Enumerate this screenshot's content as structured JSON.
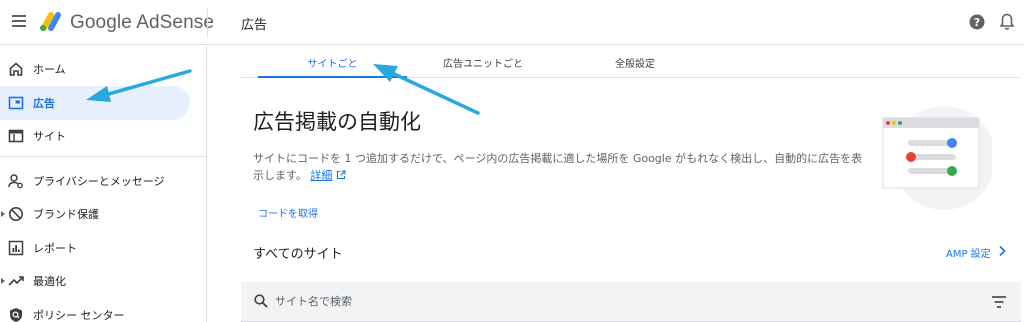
{
  "app": {
    "brand_name": "Google AdSense",
    "page_title": "広告"
  },
  "sidebar": {
    "items": [
      {
        "label": "ホーム",
        "icon": "home-icon",
        "active": false,
        "expandable": false
      },
      {
        "label": "広告",
        "icon": "ads-icon",
        "active": true,
        "expandable": false
      },
      {
        "label": "サイト",
        "icon": "sites-icon",
        "active": false,
        "expandable": false
      },
      {
        "label": "プライバシーとメッセージ",
        "icon": "privacy-icon",
        "active": false,
        "expandable": false
      },
      {
        "label": "ブランド保護",
        "icon": "block-icon",
        "active": false,
        "expandable": true
      },
      {
        "label": "レポート",
        "icon": "report-icon",
        "active": false,
        "expandable": false
      },
      {
        "label": "最適化",
        "icon": "trending-up-icon",
        "active": false,
        "expandable": true
      },
      {
        "label": "ポリシー センター",
        "icon": "policy-icon",
        "active": false,
        "expandable": false
      }
    ]
  },
  "tabs": [
    {
      "label": "サイトごと",
      "active": true
    },
    {
      "label": "広告ユニットごと",
      "active": false
    },
    {
      "label": "全般設定",
      "active": false
    }
  ],
  "main": {
    "heading": "広告掲載の自動化",
    "description_line1": "サイトにコードを 1 つ追加するだけで、ページ内の広告掲載に適した場所を Google がもれなく検出し、自動的に広告を表",
    "description_line2": "示します。",
    "details_link": "詳細",
    "get_code_button": "コードを取得",
    "all_sites_title": "すべてのサイト",
    "amp_settings_link": "AMP 設定"
  },
  "search": {
    "placeholder": "サイト名で検索"
  },
  "colors": {
    "accent": "#1a73e8",
    "active_bg": "#e8f0fe",
    "annotation_arrow": "#29a8e0"
  }
}
